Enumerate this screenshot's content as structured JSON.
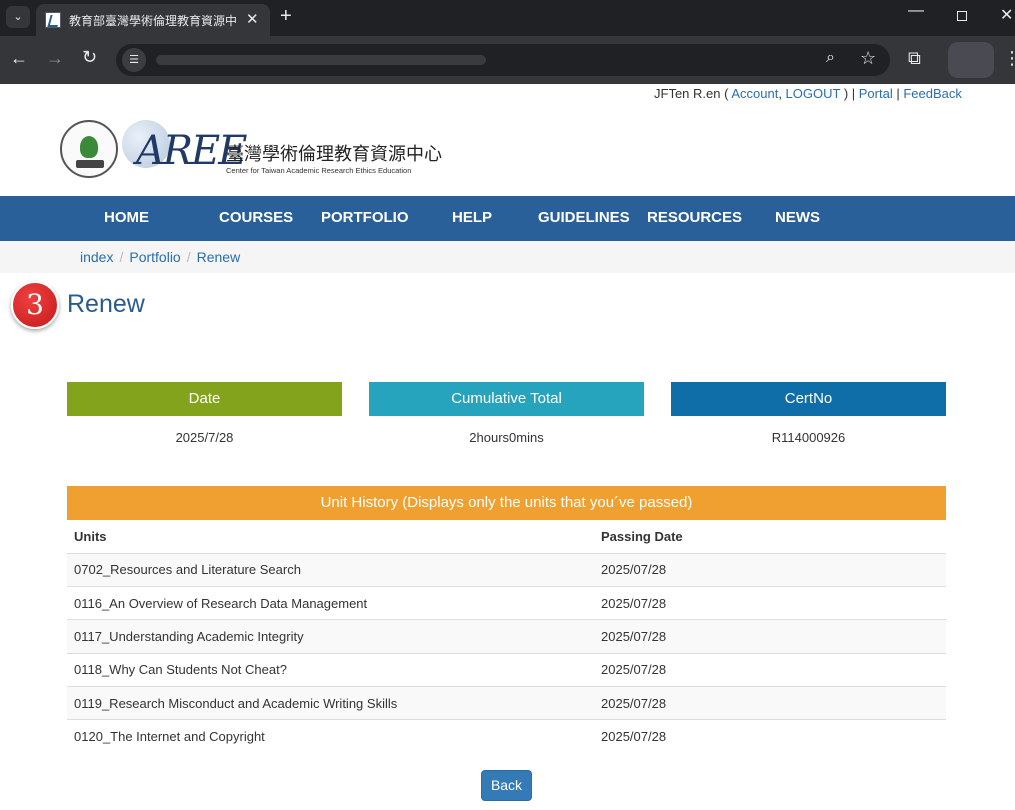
{
  "browser": {
    "tab_title": "教育部臺灣學術倫理教育資源中心",
    "tab_close": "✕",
    "new_tab": "+",
    "tab_list": "⌄",
    "win_min": "—",
    "win_close": "✕"
  },
  "userbar": {
    "user": "JFTen R.en",
    "open": " ( ",
    "account": "Account",
    "comma": ", ",
    "logout": "LOGOUT",
    "close": " ) | ",
    "portal": "Portal",
    "pipe": " | ",
    "feedback": "FeedBack"
  },
  "logo": {
    "mark": "AREE",
    "name_cn": "臺灣學術倫理教育資源中心",
    "name_en": "Center for Taiwan Academic Research Ethics Education"
  },
  "nav": {
    "home": "HOME",
    "courses": "COURSES",
    "portfolio": "PORTFOLIO",
    "help": "HELP",
    "guidelines": "GUIDELINES",
    "resources": "RESOURCES",
    "news": "NEWS"
  },
  "breadcrumb": {
    "sep": "/",
    "items": [
      "index",
      "Portfolio",
      "Renew"
    ]
  },
  "step_number": "3",
  "page_title": "Renew",
  "stats": {
    "date_label": "Date",
    "date_value": "2025/7/28",
    "total_label": "Cumulative Total",
    "total_value": "2hours0mins",
    "cert_label": "CertNo",
    "cert_value": "R114000926"
  },
  "colors": {
    "date": "#84a31c",
    "total": "#27a4bd",
    "cert": "#0f6ea8"
  },
  "history": {
    "title": "Unit History (Displays only the units that you´ve passed)",
    "columns": [
      "Units",
      "Passing Date"
    ],
    "rows": [
      [
        "0702_Resources and Literature Search",
        "2025/07/28"
      ],
      [
        "0116_An Overview of Research Data Management",
        "2025/07/28"
      ],
      [
        "0117_Understanding Academic Integrity",
        "2025/07/28"
      ],
      [
        "0118_Why Can Students Not Cheat?",
        "2025/07/28"
      ],
      [
        "0119_Research Misconduct and Academic Writing Skills",
        "2025/07/28"
      ],
      [
        "0120_The Internet and Copyright",
        "2025/07/28"
      ]
    ]
  },
  "back_label": "Back"
}
